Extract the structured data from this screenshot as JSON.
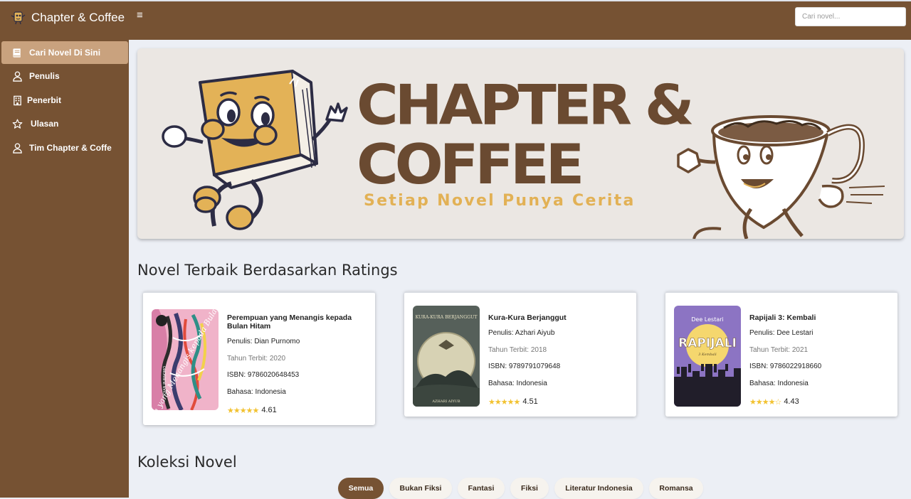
{
  "app": {
    "brand": "Chapter & Coffee",
    "search_placeholder": "Cari novel..."
  },
  "colors": {
    "primary_brown": "#765233",
    "active_nav": "#c9a27e",
    "title_brown": "#6a4a31",
    "tagline_gold": "#e2b155",
    "star": "#f2c230"
  },
  "sidebar": {
    "items": [
      {
        "label": "Cari Novel Di Sini",
        "icon": "book-icon",
        "active": true
      },
      {
        "label": "Penulis",
        "icon": "person-icon",
        "active": false
      },
      {
        "label": "Penerbit",
        "icon": "building-icon",
        "active": false
      },
      {
        "label": "Ulasan",
        "icon": "star-icon",
        "active": false
      },
      {
        "label": "Tim Chapter & Coffe",
        "icon": "person-icon",
        "active": false
      }
    ]
  },
  "hero": {
    "title_line1": "CHAPTER &",
    "title_line2": "COFFEE",
    "tagline": "Setiap Novel Punya Cerita"
  },
  "top_rated": {
    "heading": "Novel Terbaik Berdasarkan Ratings",
    "books": [
      {
        "title": "Perempuan yang Menangis kepada Bulan Hitam",
        "author": "Penulis: Dian Purnomo",
        "year": "Tahun Terbit: 2020",
        "isbn": "ISBN: 9786020648453",
        "language": "Bahasa: Indonesia",
        "rating": "4.61",
        "stars": "★★★★★",
        "cover_text": "Perempuan yang Menangis kepada Bulan Hitam",
        "cover_author": "DIAN PURNOMO"
      },
      {
        "title": "Kura-Kura Berjanggut",
        "author": "Penulis: Azhari Aiyub",
        "year": "Tahun Terbit: 2018",
        "isbn": "ISBN: 9789791079648",
        "language": "Bahasa: Indonesia",
        "rating": "4.51",
        "stars": "★★★★★",
        "cover_text": "KURA-KURA BERJANGGUT",
        "cover_author": "AZHARI AIYUB"
      },
      {
        "title": "Rapijali 3: Kembali",
        "author": "Penulis: Dee Lestari",
        "year": "Tahun Terbit: 2021",
        "isbn": "ISBN: 9786022918660",
        "language": "Bahasa: Indonesia",
        "rating": "4.43",
        "stars": "★★★★☆",
        "cover_author": "Dee Lestari",
        "cover_text": "RAPIJALI",
        "cover_sub": "3 Kembali"
      }
    ]
  },
  "collection": {
    "heading": "Koleksi Novel",
    "filters": [
      {
        "label": "Semua",
        "active": true
      },
      {
        "label": "Bukan Fiksi",
        "active": false
      },
      {
        "label": "Fantasi",
        "active": false
      },
      {
        "label": "Fiksi",
        "active": false
      },
      {
        "label": "Literatur Indonesia",
        "active": false
      },
      {
        "label": "Romansa",
        "active": false
      }
    ]
  }
}
